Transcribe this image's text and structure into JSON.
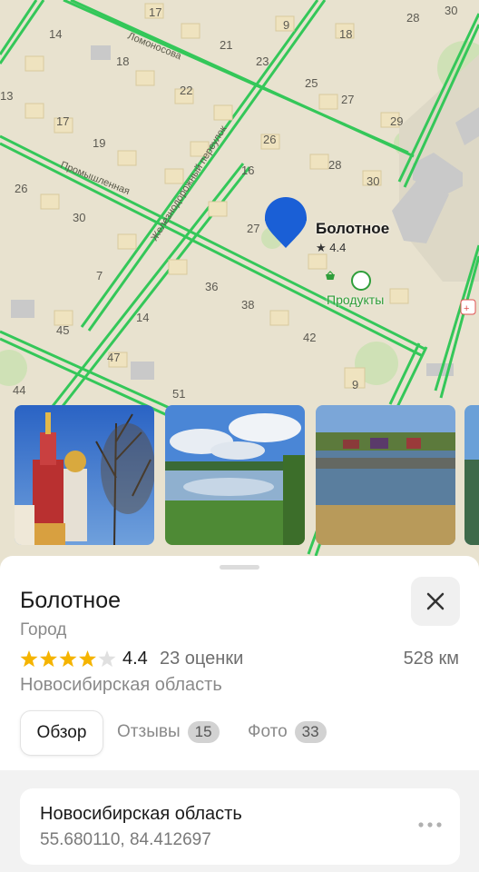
{
  "map": {
    "place_name": "Болотное",
    "place_rating": "★ 4.4",
    "poi_label": "Продукты",
    "streets": [
      "Ломоносова",
      "Промышленная",
      "Железнодорожный переулок"
    ],
    "house_numbers": [
      "17",
      "9",
      "28",
      "30",
      "14",
      "21",
      "18",
      "18",
      "23",
      "22",
      "25",
      "13",
      "27",
      "17",
      "29",
      "19",
      "26",
      "16",
      "28",
      "30",
      "26",
      "30",
      "27",
      "7",
      "36",
      "38",
      "14",
      "45",
      "42",
      "47",
      "44",
      "51",
      "9"
    ]
  },
  "photos": [
    {
      "subject": "church-photo"
    },
    {
      "subject": "lake-photo"
    },
    {
      "subject": "village-pond-photo"
    },
    {
      "subject": "partial-photo"
    }
  ],
  "place": {
    "name": "Болотное",
    "type": "Город",
    "rating": "4.4",
    "rating_stars": 4,
    "reviews": "23 оценки",
    "distance": "528 км",
    "region": "Новосибирская область"
  },
  "tabs": [
    {
      "label": "Обзор",
      "active": true
    },
    {
      "label": "Отзывы",
      "count": "15"
    },
    {
      "label": "Фото",
      "count": "33"
    }
  ],
  "info": {
    "title": "Новосибирская область",
    "coordinates": "55.680110, 84.412697"
  },
  "colors": {
    "accent": "#1a5fd6",
    "star": "#f5b400",
    "road": "#34c759",
    "map_bg": "#e8e2cf",
    "poi": "#2e9e3a"
  }
}
